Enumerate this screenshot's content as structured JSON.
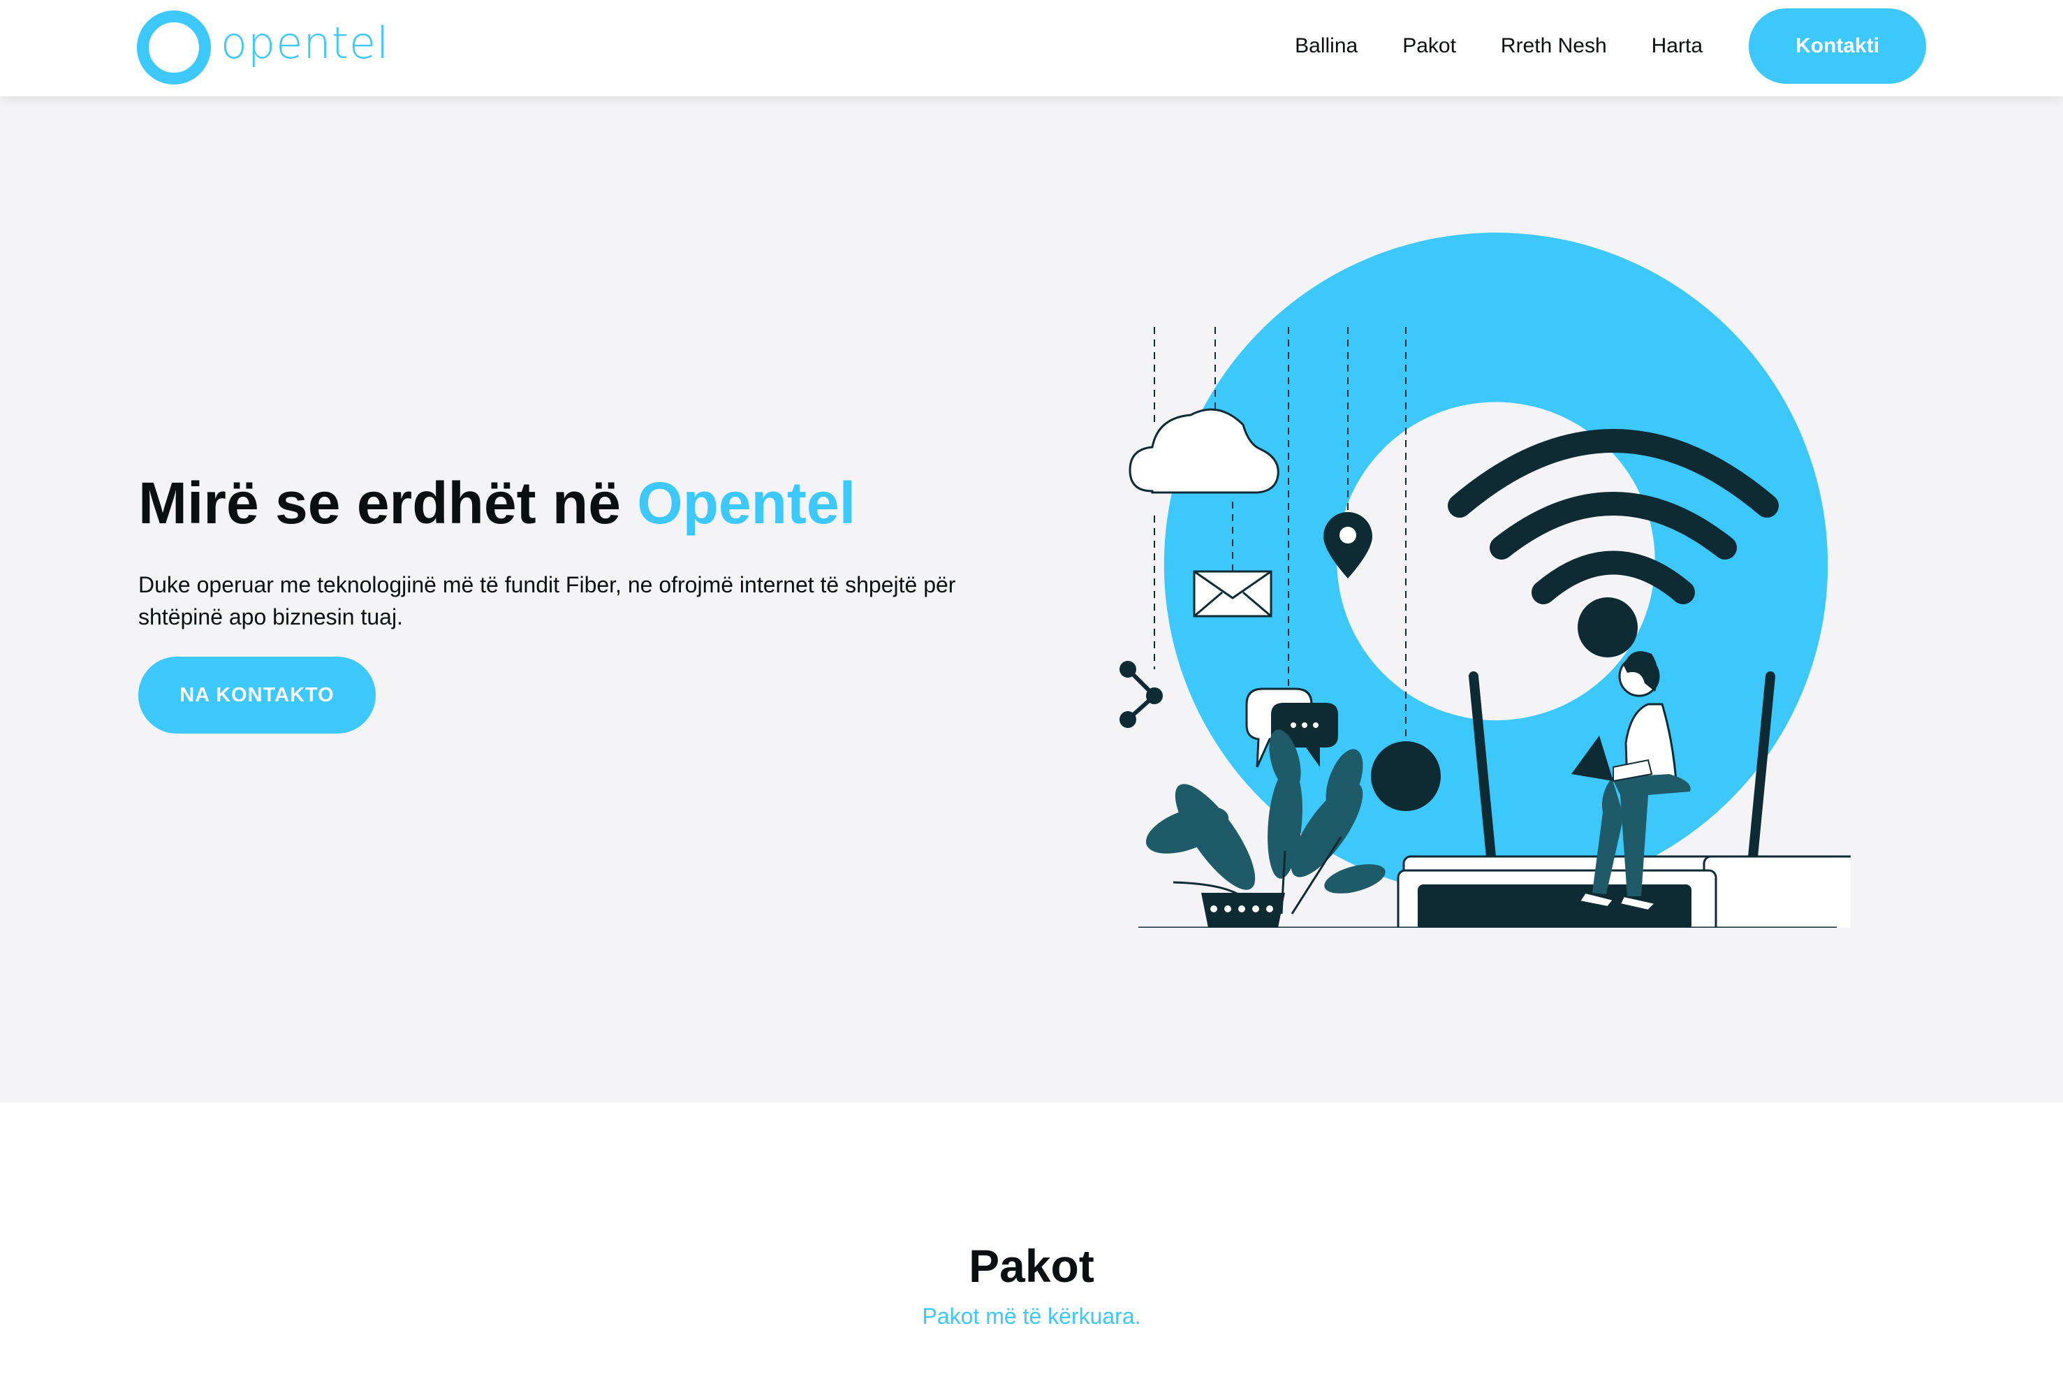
{
  "brand": {
    "name": "opentel",
    "accent_color": "#3cc8fa",
    "dark_color": "#0e2a33"
  },
  "nav": {
    "items": [
      "Ballina",
      "Pakot",
      "Rreth Nesh",
      "Harta"
    ],
    "cta_label": "Kontakti"
  },
  "hero": {
    "title_prefix": "Mirë se erdhët në ",
    "title_accent": "Opentel",
    "description": "Duke operuar me teknologjinë më të fundit Fiber, ne ofrojmë internet të shpejtë për shtëpinë apo biznesin tuaj.",
    "button_label": "NA KONTAKTO"
  },
  "packages": {
    "title": "Pakot",
    "subtitle": "Pakot më të kërkuara."
  }
}
